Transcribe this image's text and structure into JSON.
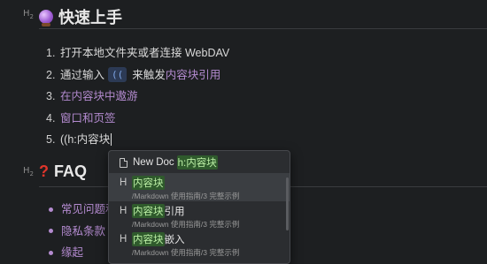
{
  "section1": {
    "marker": "H2",
    "title": "快速上手",
    "items": [
      {
        "num": "1.",
        "text": "打开本地文件夹或者连接 WebDAV"
      },
      {
        "num": "2.",
        "prefix": "通过输入",
        "chip": "((",
        "suffix": "来触发",
        "link": "内容块引用"
      },
      {
        "num": "3.",
        "link": "在内容块中遨游"
      },
      {
        "num": "4.",
        "link": "窗口和页签"
      },
      {
        "num": "5.",
        "text": "((h:内容块"
      }
    ]
  },
  "section2": {
    "marker": "H2",
    "title": "FAQ",
    "items": [
      "常见问题和",
      "隐私条款",
      "缘起"
    ]
  },
  "popup": {
    "new_doc_label": "New Doc",
    "new_doc_highlight": "h:内容块",
    "results": [
      {
        "type": "H",
        "highlight": "内容块",
        "rest": "",
        "path": "/Markdown 使用指南/3 完整示例"
      },
      {
        "type": "H",
        "highlight": "内容块",
        "rest": "引用",
        "path": "/Markdown 使用指南/3 完整示例"
      },
      {
        "type": "H",
        "highlight": "内容块",
        "rest": "嵌入",
        "path": "/Markdown 使用指南/3 完整示例"
      }
    ]
  },
  "colors": {
    "background": "#1d1f21",
    "link": "#b48bd0",
    "highlight": "#2f5a2c"
  }
}
